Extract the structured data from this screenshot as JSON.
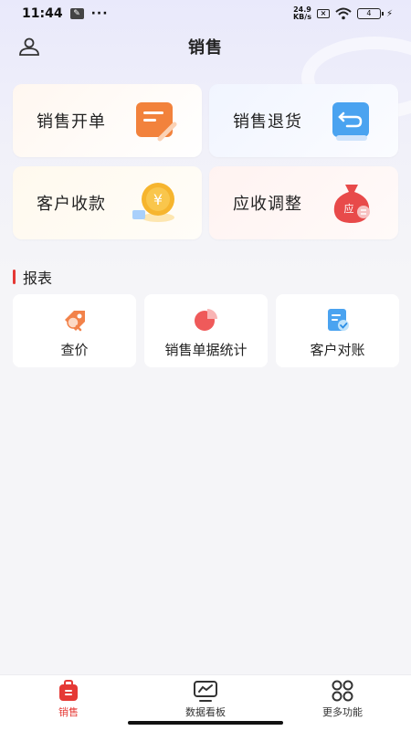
{
  "status_bar": {
    "time": "11:44",
    "net_speed_top": "24.9",
    "net_speed_bottom": "KB/s",
    "battery": "4"
  },
  "header": {
    "title": "销售"
  },
  "quick_actions": [
    {
      "label": "销售开单",
      "icon": "sales-order-icon"
    },
    {
      "label": "销售退货",
      "icon": "sales-return-icon"
    },
    {
      "label": "客户收款",
      "icon": "customer-payment-icon"
    },
    {
      "label": "应收调整",
      "icon": "receivable-adjust-icon"
    }
  ],
  "reports": {
    "title": "报表",
    "items": [
      {
        "label": "查价",
        "icon": "price-check-icon"
      },
      {
        "label": "销售单据统计",
        "icon": "pie-chart-icon"
      },
      {
        "label": "客户对账",
        "icon": "reconcile-icon"
      }
    ]
  },
  "tabbar": {
    "items": [
      {
        "label": "销售",
        "icon": "sales-tab-icon",
        "active": true
      },
      {
        "label": "数据看板",
        "icon": "dashboard-tab-icon",
        "active": false
      },
      {
        "label": "更多功能",
        "icon": "more-functions-tab-icon",
        "active": false
      }
    ]
  },
  "colors": {
    "accent": "#e53935",
    "background": "#f5f5f8"
  }
}
